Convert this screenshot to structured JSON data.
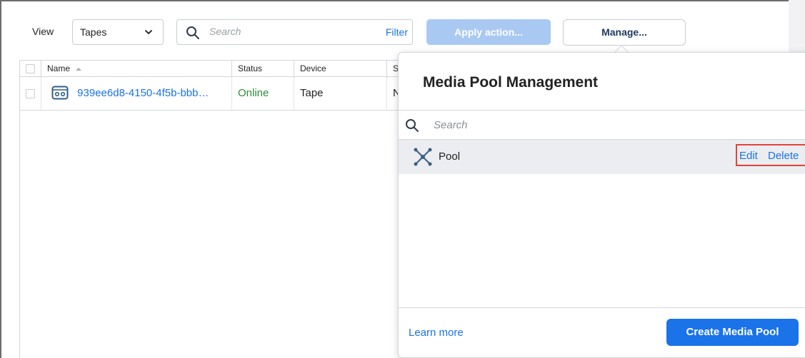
{
  "toolbar": {
    "view_label": "View",
    "view_select_value": "Tapes",
    "search_placeholder": "Search",
    "filter_label": "Filter",
    "apply_action_label": "Apply action...",
    "manage_label": "Manage..."
  },
  "table": {
    "columns": [
      "Name",
      "Status",
      "Device",
      "S"
    ],
    "rows": [
      {
        "name": "939ee6d8-4150-4f5b-bbb…",
        "status": "Online",
        "device": "Tape",
        "extra": "N"
      }
    ]
  },
  "popover": {
    "title": "Media Pool Management",
    "search_placeholder": "Search",
    "pools": [
      {
        "name": "Pool",
        "edit_label": "Edit",
        "delete_label": "Delete"
      }
    ],
    "learn_more_label": "Learn more",
    "create_label": "Create Media Pool"
  },
  "colors": {
    "accent": "#1a73e8",
    "status_online": "#2e8b3a",
    "disabled_button": "#a9c9f3",
    "highlight_border": "#e3433a"
  },
  "icons": [
    "chevron-down-icon",
    "search-icon",
    "sort-up-icon",
    "tape-icon",
    "pool-icon"
  ]
}
